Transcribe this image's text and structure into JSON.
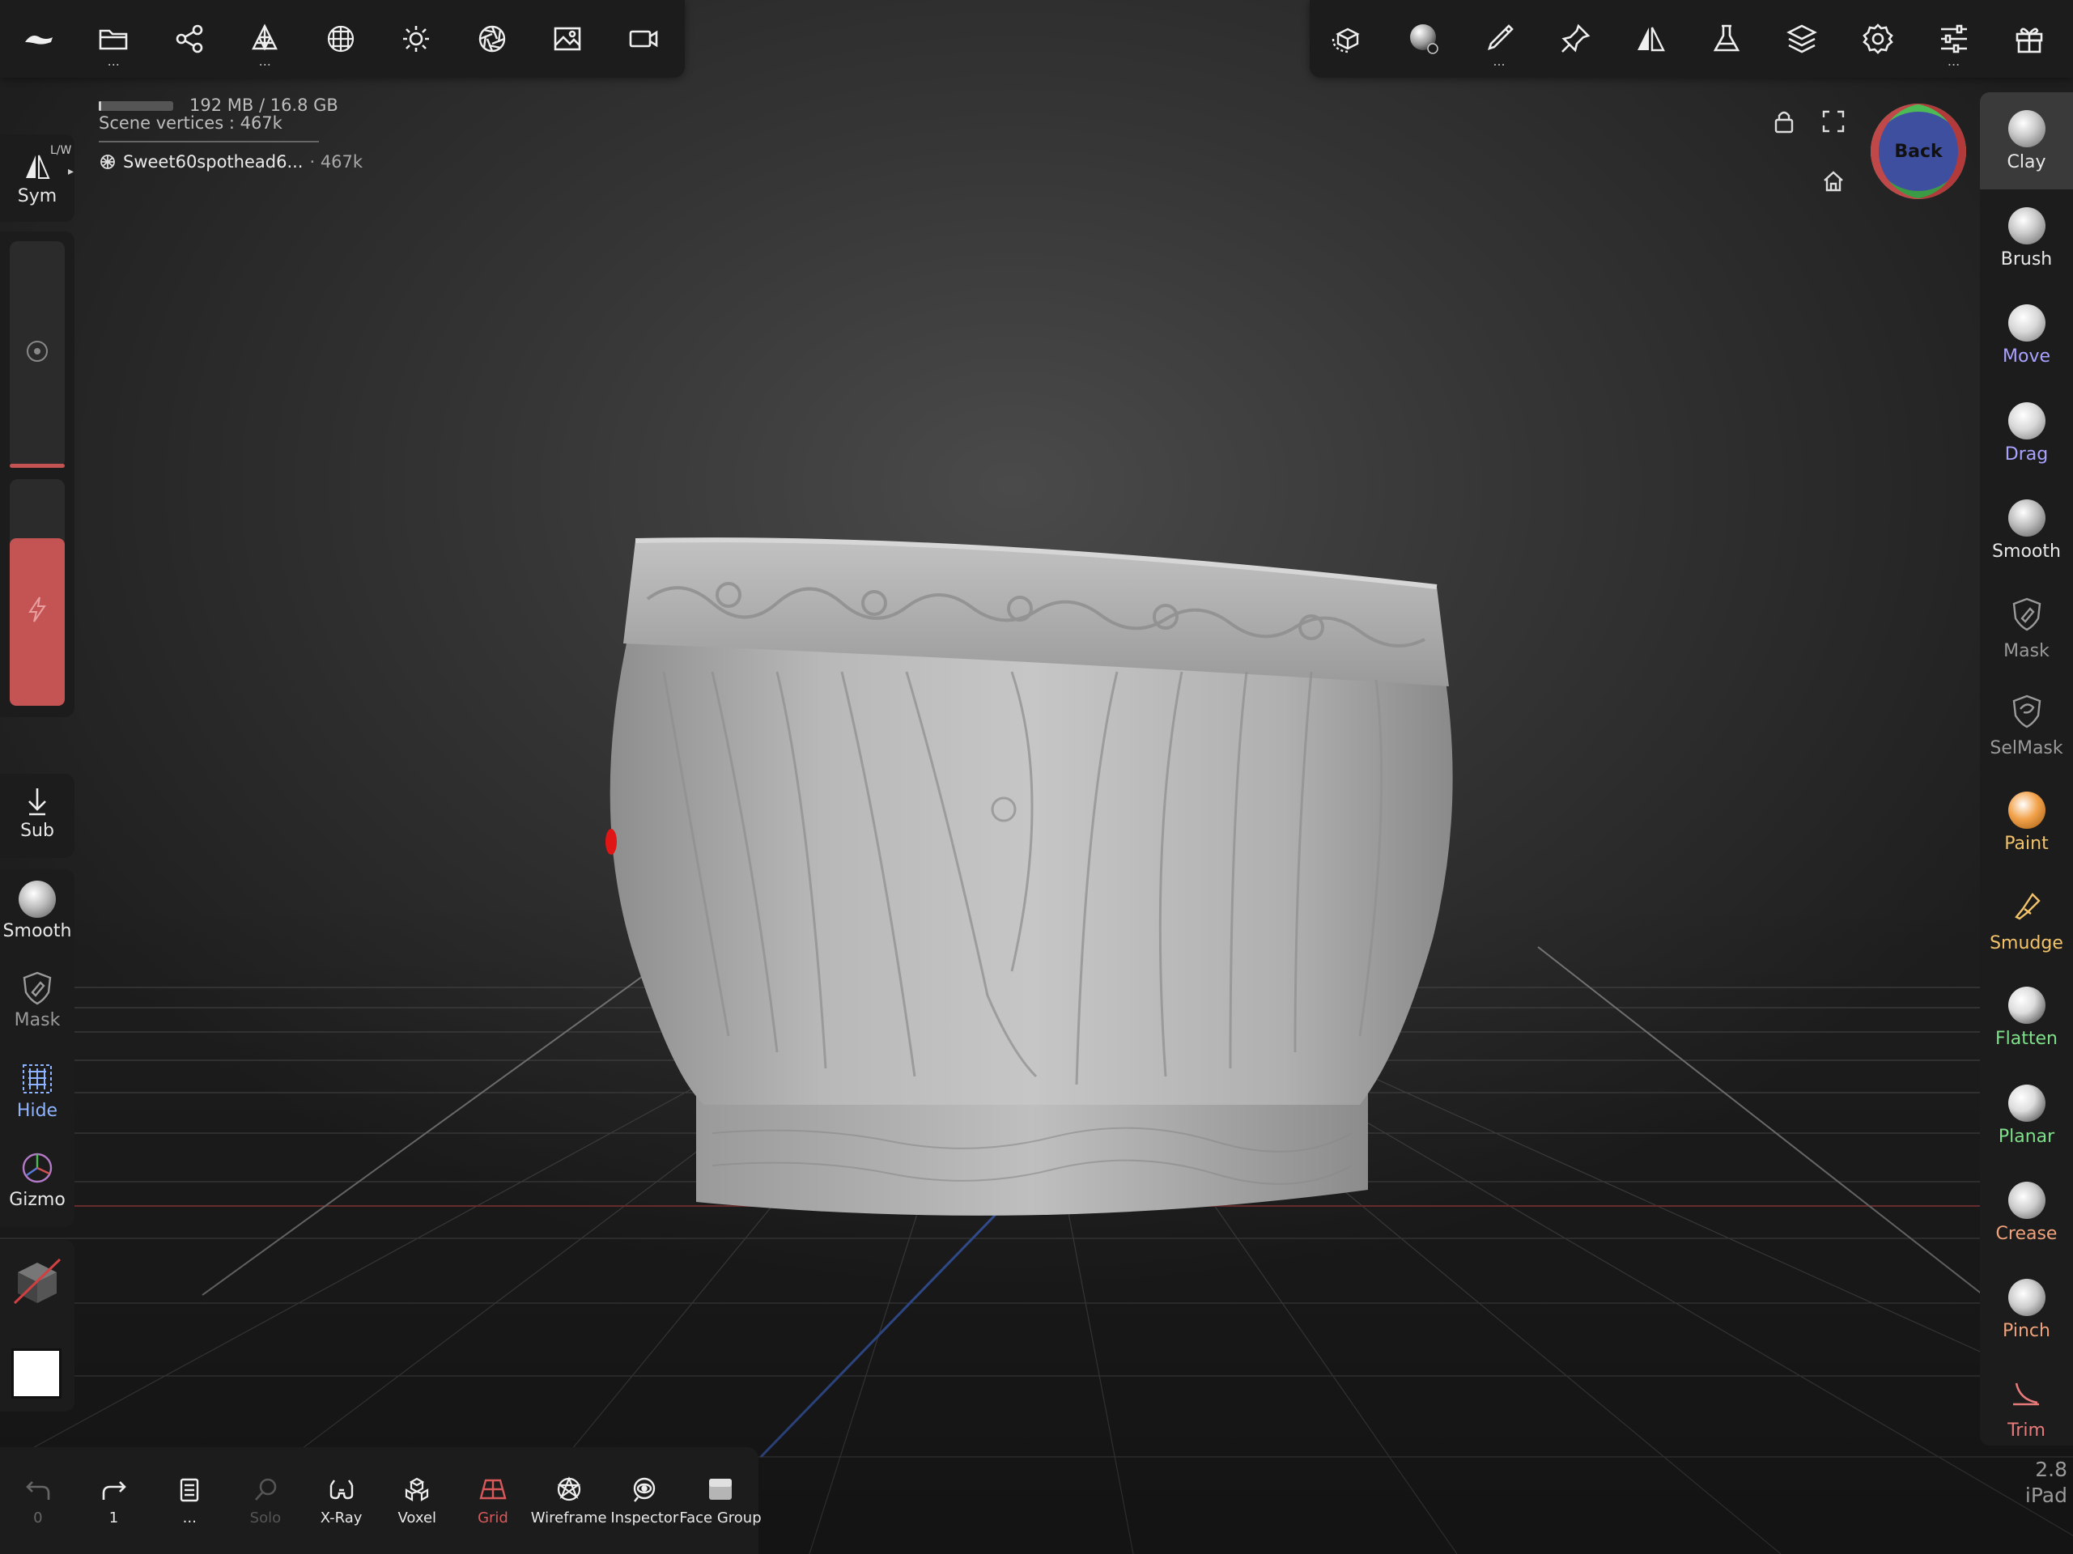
{
  "info": {
    "memory": "192 MB / 16.8 GB",
    "scene_vertices": "Scene vertices : 467k",
    "mesh_name": "Sweet60spothead6...",
    "mesh_vertices": "· 467k",
    "memory_fraction": 0.03
  },
  "top_left_toolbar": [
    "logo-icon",
    "folder-icon",
    "share-icon",
    "topology-icon",
    "grid-sphere-icon",
    "sun-icon",
    "aperture-icon",
    "image-icon",
    "camera-icon"
  ],
  "top_right_toolbar": [
    "rotate-cube-icon",
    "matcap-sphere-icon",
    "brush-pen-icon",
    "pin-icon",
    "symmetry-icon",
    "flask-icon",
    "layers-icon",
    "settings-icon",
    "sliders-icon",
    "gift-icon"
  ],
  "left_panel": {
    "sym": {
      "label": "Sym",
      "badge": "L/W"
    },
    "sub": {
      "label": "Sub"
    },
    "tools": [
      {
        "label": "Smooth",
        "color": "#e8e8e8"
      },
      {
        "label": "Mask",
        "color": "#9a9a9a"
      },
      {
        "label": "Hide",
        "color": "#8fb4ff"
      },
      {
        "label": "Gizmo",
        "color": "#e8e8e8"
      }
    ],
    "intensity_fraction": 0.74
  },
  "right_panel": {
    "tools": [
      {
        "label": "Clay",
        "color": "#e8e8e8",
        "active": true
      },
      {
        "label": "Brush",
        "color": "#e8e8e8"
      },
      {
        "label": "Move",
        "color": "#a9a3ff"
      },
      {
        "label": "Drag",
        "color": "#a9a3ff"
      },
      {
        "label": "Smooth",
        "color": "#e8e8e8"
      },
      {
        "label": "Mask",
        "color": "#9a9a9a"
      },
      {
        "label": "SelMask",
        "color": "#9a9a9a"
      },
      {
        "label": "Paint",
        "color": "#f3c36b"
      },
      {
        "label": "Smudge",
        "color": "#f3c36b"
      },
      {
        "label": "Flatten",
        "color": "#7fe08a"
      },
      {
        "label": "Planar",
        "color": "#7fe08a"
      },
      {
        "label": "Crease",
        "color": "#f0a27a"
      },
      {
        "label": "Pinch",
        "color": "#f0a27a"
      },
      {
        "label": "Trim",
        "color": "#e87a7a"
      }
    ]
  },
  "view": {
    "cube_label": "Back"
  },
  "bottom_bar": [
    {
      "label": "0",
      "icon": "undo-icon",
      "dim": true
    },
    {
      "label": "1",
      "icon": "redo-icon",
      "dim": false
    },
    {
      "label": "...",
      "icon": "history-icon",
      "dim": false
    },
    {
      "label": "Solo",
      "icon": "solo-icon",
      "dim": true
    },
    {
      "label": "X-Ray",
      "icon": "xray-icon",
      "dim": false
    },
    {
      "label": "Voxel",
      "icon": "voxel-icon",
      "dim": false
    },
    {
      "label": "Grid",
      "icon": "grid-icon",
      "dim": false,
      "accent": "#d9585a"
    },
    {
      "label": "Wireframe",
      "icon": "wireframe-icon",
      "dim": false
    },
    {
      "label": "Inspector",
      "icon": "inspector-icon",
      "dim": false
    },
    {
      "label": "Face Group",
      "icon": "face-group-icon",
      "dim": false
    }
  ],
  "version": {
    "number": "2.8",
    "device": "iPad"
  },
  "colors": {
    "panel": "#1c1c1c",
    "accent_red": "#c45353",
    "viewport": "#333333"
  }
}
